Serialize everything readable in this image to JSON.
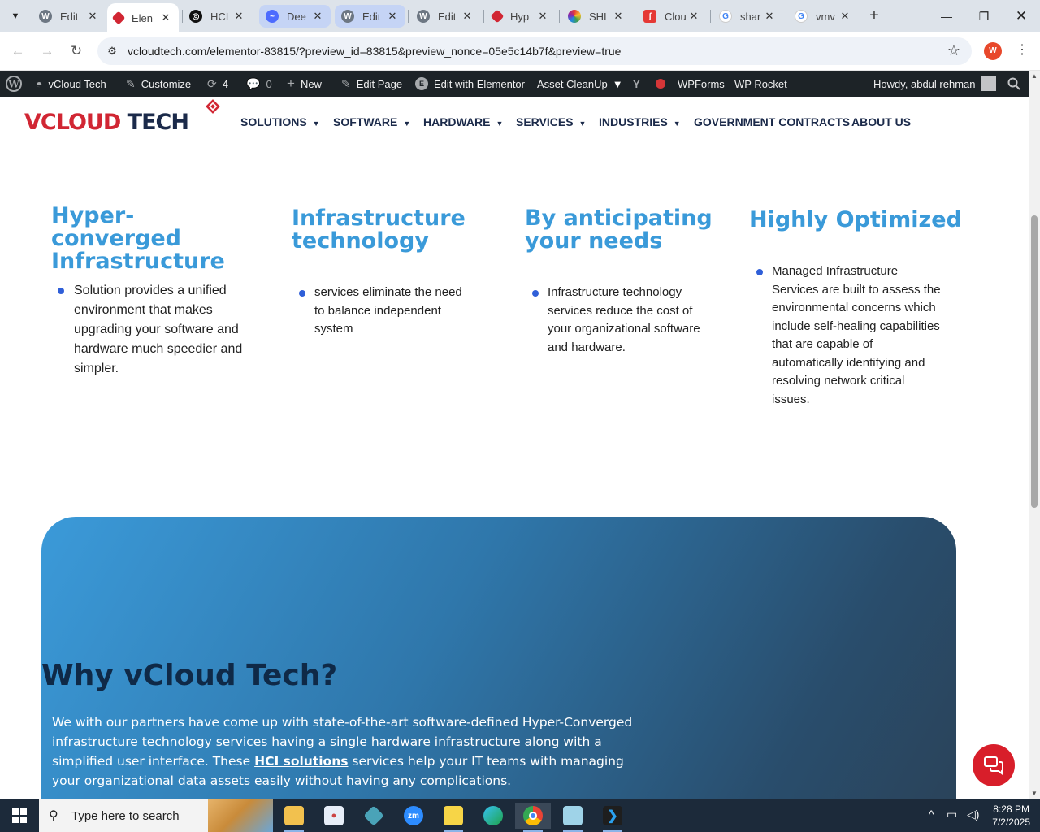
{
  "browser": {
    "tabs": [
      {
        "title": "Edit"
      },
      {
        "title": "Elen"
      },
      {
        "title": "HCI"
      },
      {
        "title": "Dee"
      },
      {
        "title": "Edit"
      },
      {
        "title": "Edit"
      },
      {
        "title": "Hyp"
      },
      {
        "title": "SHI"
      },
      {
        "title": "Clou"
      },
      {
        "title": "shar"
      },
      {
        "title": "vmv"
      }
    ],
    "new_tab": "+",
    "url": "vcloudtech.com/elementor-83815/?preview_id=83815&preview_nonce=05e5c14b7f&preview=true",
    "profile_initial": "W"
  },
  "wp_admin_bar": {
    "site_name": "vCloud Tech",
    "customize": "Customize",
    "updates_count": "4",
    "comments_count": "0",
    "new": "New",
    "edit_page": "Edit Page",
    "edit_elementor": "Edit with Elementor",
    "asset_cleanup": "Asset CleanUp",
    "wpforms": "WPForms",
    "wp_rocket": "WP Rocket",
    "howdy": "Howdy, abdul rehman"
  },
  "site": {
    "logo_part1": "VCLOUD",
    "logo_part2": " TECH",
    "nav": [
      {
        "label": "SOLUTIONS",
        "has_caret": true
      },
      {
        "label": "SOFTWARE",
        "has_caret": true
      },
      {
        "label": "HARDWARE",
        "has_caret": true
      },
      {
        "label": "SERVICES",
        "has_caret": true
      },
      {
        "label": "INDUSTRIES",
        "has_caret": true
      },
      {
        "label": "GOVERNMENT CONTRACTS",
        "has_caret": false
      },
      {
        "label": "ABOUT US",
        "has_caret": false
      }
    ],
    "features": [
      {
        "title": "Hyper-converged Infrastructure",
        "text": "Solution provides a unified environment that makes upgrading your software and hardware much speedier and simpler."
      },
      {
        "title": "Infrastructure technology",
        "text": "services eliminate the need to balance independent system"
      },
      {
        "title": "By anticipating your needs",
        "text": "Infrastructure technology services reduce the cost of your organizational software and hardware."
      },
      {
        "title": "Highly Optimized",
        "text": "Managed Infrastructure Services are built to assess the environmental concerns which include self-healing capabilities that are capable of automatically identifying and resolving network critical issues."
      }
    ],
    "why": {
      "title": "Why vCloud Tech?",
      "text_before": "We with our partners have come up with state-of-the-art software-defined Hyper-Converged infrastructure technology services having a single hardware infrastructure along with a simplified user interface. These ",
      "link": "HCI solutions",
      "text_after": " services help your IT teams with managing your organizational data assets easily without having any complications."
    }
  },
  "taskbar": {
    "search_placeholder": "Type here to search",
    "time": "8:28 PM",
    "date": "7/2/2025"
  },
  "colors": {
    "accent_blue": "#3a9ad9",
    "brand_red": "#d12633",
    "navy": "#1b2a4a"
  }
}
